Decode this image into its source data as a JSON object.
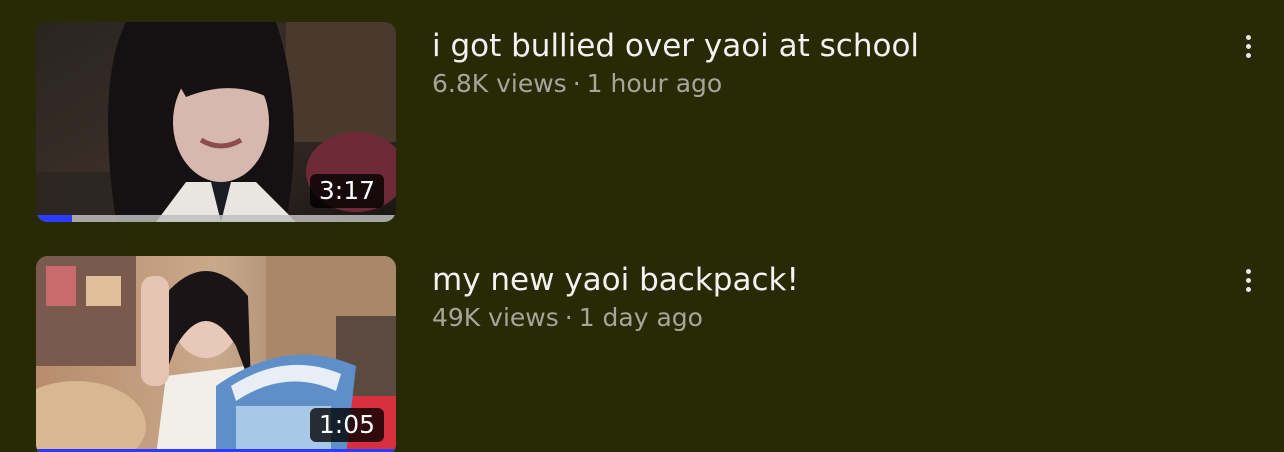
{
  "videos": [
    {
      "title": "i got bullied over yaoi at school",
      "views": "6.8K views",
      "separator": "·",
      "age": "1 hour ago",
      "duration": "3:17",
      "watch_progress": 0.1,
      "menu_icon": "more-vert-icon"
    },
    {
      "title": "my new yaoi backpack!",
      "views": "49K views",
      "separator": "·",
      "age": "1 day ago",
      "duration": "1:05",
      "watch_progress": 1.0,
      "menu_icon": "more-vert-icon"
    }
  ],
  "colors": {
    "background": "#272a04",
    "title_text": "#f2f2f2",
    "meta_text": "#a6a59a",
    "progress_fill": "#2b3cff",
    "duration_badge_bg": "#000000"
  }
}
